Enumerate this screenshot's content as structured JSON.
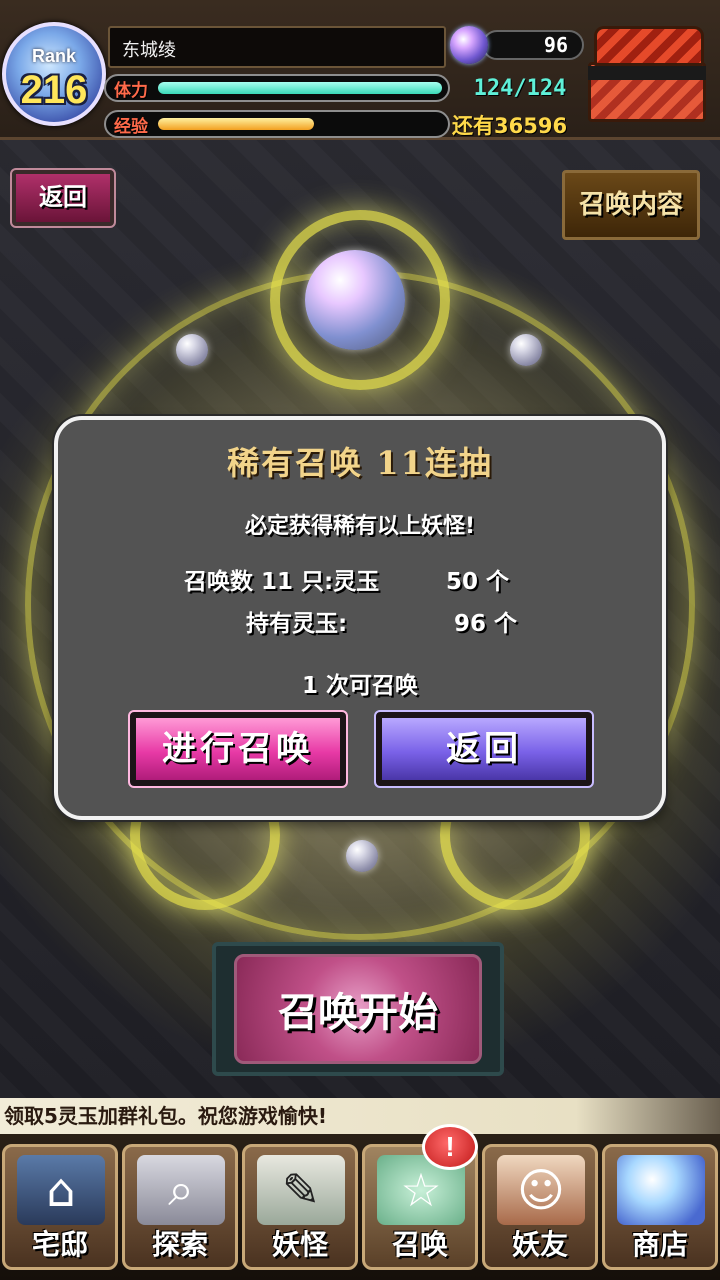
{
  "player": {
    "rank_label": "Rank",
    "rank": "216",
    "name": "东城绫",
    "stamina_label": "体力",
    "stamina_value": "124/124",
    "stamina_fraction": 1.0,
    "exp_label": "经验",
    "exp_fraction": 0.55,
    "exp_remaining": "还有36596",
    "gems": "96"
  },
  "header": {
    "back_label": "返回",
    "contents_label": "召唤内容"
  },
  "dialog": {
    "title": "稀有召唤 11连抽",
    "subtitle": "必定获得稀有以上妖怪!",
    "cost_label": "召唤数 11 只:灵玉",
    "cost_value": "50 个",
    "hold_label": "持有灵玉:",
    "hold_value": " 96 个",
    "times_text": "1 次可召唤",
    "confirm_label": "进行召唤",
    "cancel_label": "返回"
  },
  "summon_start_label": "召唤开始",
  "ticker_text": "领取5灵玉加群礼包。祝您游戏愉快!",
  "nav": {
    "items": [
      {
        "label": "宅邸",
        "icon": "house-icon"
      },
      {
        "label": "探索",
        "icon": "magnifier-icon"
      },
      {
        "label": "妖怪",
        "icon": "scroll-icon"
      },
      {
        "label": "召唤",
        "icon": "pentagram-icon"
      },
      {
        "label": "妖友",
        "icon": "fox-girl-icon"
      },
      {
        "label": "商店",
        "icon": "crystal-ball-icon"
      }
    ],
    "alert": "!"
  },
  "colors": {
    "confirm_button": "#e83aa6",
    "cancel_button": "#7a62e8",
    "title_gold": "#f2d48a",
    "stamina_bar": "#3ad9b8",
    "exp_bar": "#f3a020"
  }
}
